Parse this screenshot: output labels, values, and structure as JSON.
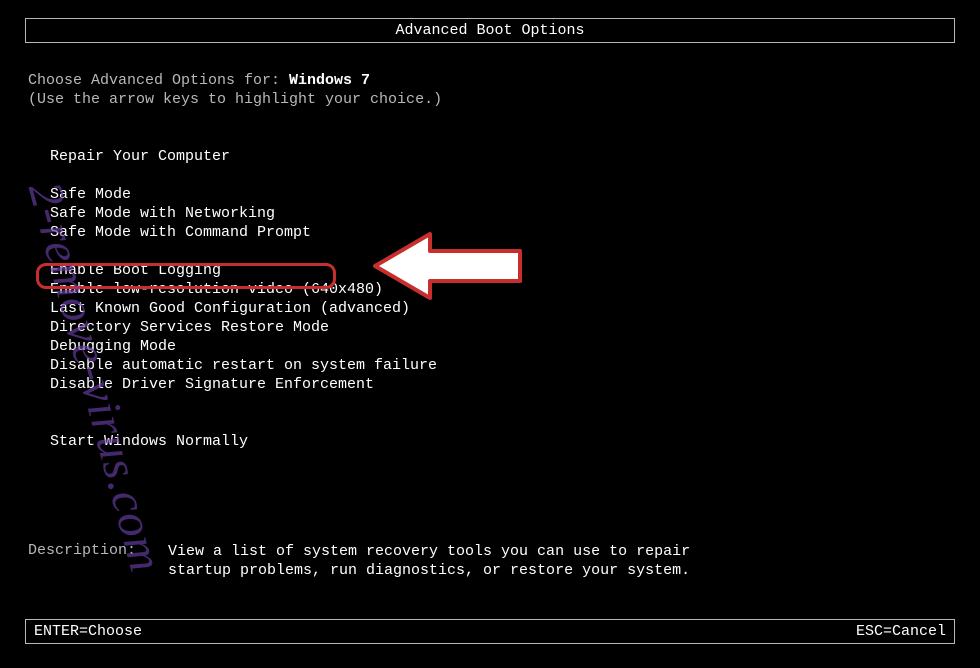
{
  "title": "Advanced Boot Options",
  "choose_prefix": "Choose Advanced Options for: ",
  "os_name": "Windows 7",
  "hint": "(Use the arrow keys to highlight your choice.)",
  "repair": "Repair Your Computer",
  "safe_modes": {
    "sm": "Safe Mode",
    "smn": "Safe Mode with Networking",
    "smcp": "Safe Mode with Command Prompt"
  },
  "options": {
    "boot_log": "Enable Boot Logging",
    "low_res": "Enable low-resolution video (640x480)",
    "lkgc": "Last Known Good Configuration (advanced)",
    "dsrm": "Directory Services Restore Mode",
    "debug": "Debugging Mode",
    "no_restart": "Disable automatic restart on system failure",
    "no_sig": "Disable Driver Signature Enforcement"
  },
  "start_normally": "Start Windows Normally",
  "description": {
    "label": "Description:",
    "text": "View a list of system recovery tools you can use to repair startup problems, run diagnostics, or restore your system."
  },
  "footer": {
    "enter": "ENTER=Choose",
    "esc": "ESC=Cancel"
  },
  "watermark": "2-remove-virus.com"
}
